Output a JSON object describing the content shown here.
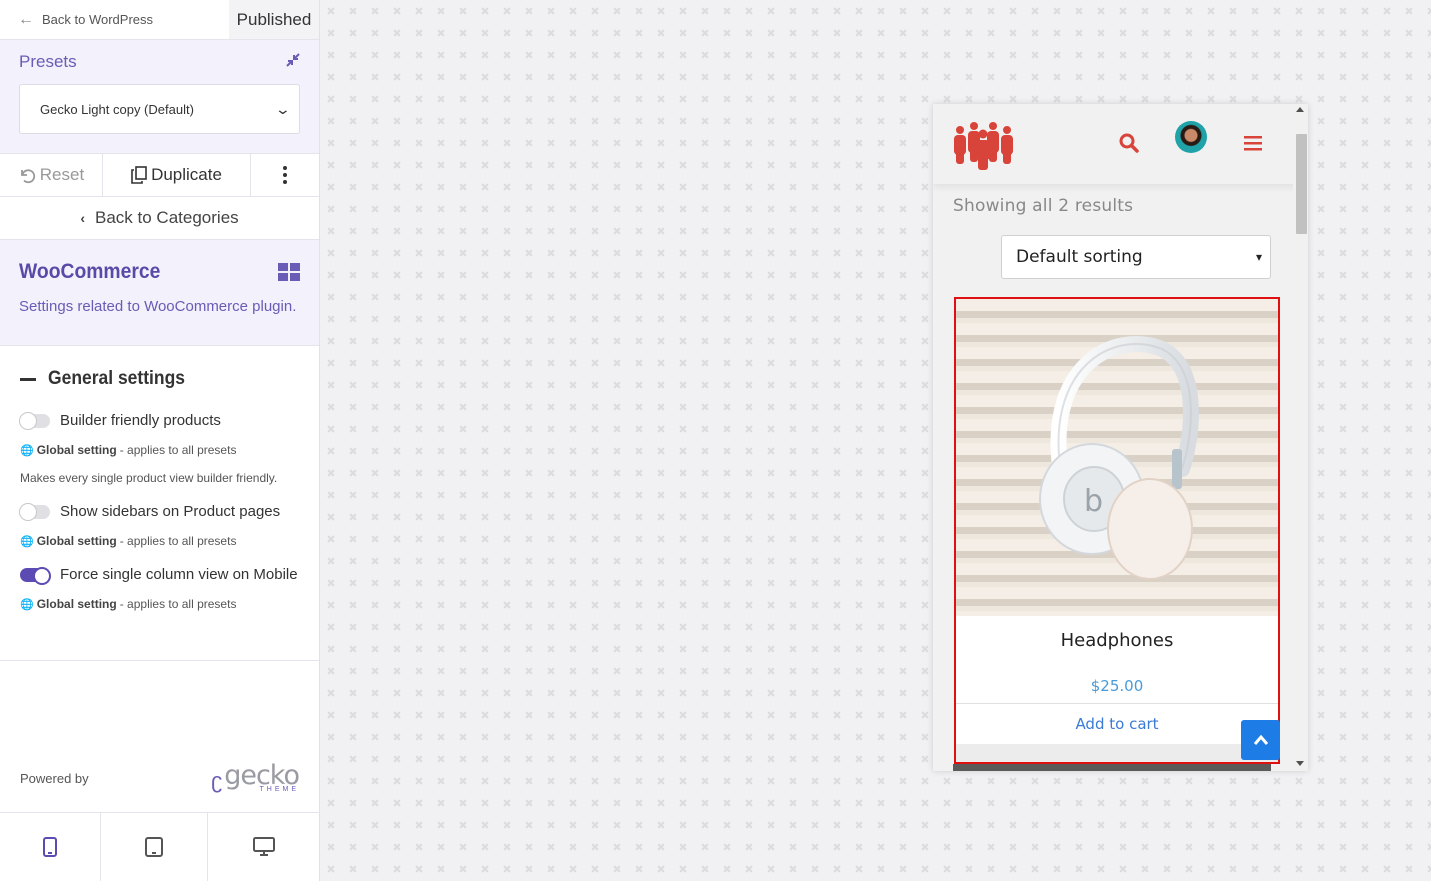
{
  "topbar": {
    "back_label": "Back to WordPress",
    "status": "Published"
  },
  "presets": {
    "title": "Presets",
    "selected": "Gecko Light copy (Default)"
  },
  "actions": {
    "reset": "Reset",
    "duplicate": "Duplicate"
  },
  "nav": {
    "back_categories": "Back to Categories"
  },
  "section": {
    "title": "WooCommerce",
    "description": "Settings related to WooCommerce plugin."
  },
  "general": {
    "title": "General settings",
    "settings": [
      {
        "label": "Builder friendly products",
        "enabled": false,
        "global_bold": "Global setting",
        "global_rest": " - applies to all presets",
        "description": "Makes every single product view builder friendly."
      },
      {
        "label": "Show sidebars on Product pages",
        "enabled": false,
        "global_bold": "Global setting",
        "global_rest": " - applies to all presets"
      },
      {
        "label": "Force single column view on Mobile",
        "enabled": true,
        "global_bold": "Global setting",
        "global_rest": " - applies to all presets"
      }
    ]
  },
  "footer": {
    "powered_by": "Powered by",
    "brand_word": "gecko",
    "brand_sub": "THEME"
  },
  "preview": {
    "results_text": "Showing all 2 results",
    "sorting": "Default sorting",
    "product": {
      "name": "Headphones",
      "price": "$25.00",
      "cta": "Add to cart"
    }
  },
  "colors": {
    "accent": "#5b4bb3",
    "highlight": "#e01010",
    "logo": "#d9443a",
    "link": "#3a7bd5"
  }
}
